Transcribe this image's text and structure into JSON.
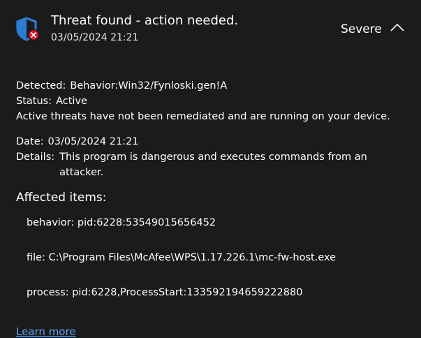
{
  "header": {
    "title": "Threat found - action needed.",
    "timestamp": "03/05/2024 21:21",
    "severity": "Severe",
    "icon": "shield-warning-icon",
    "accent_color": "#2b7cd3",
    "alert_color": "#e81123"
  },
  "threat": {
    "detected_label": "Detected:",
    "detected_value": "Behavior:Win32/Fynloski.gen!A",
    "status_label": "Status:",
    "status_value": "Active",
    "status_message": "Active threats have not been remediated and are running on your device.",
    "date_label": "Date:",
    "date_value": "03/05/2024 21:21",
    "details_label": "Details:",
    "details_value": "This program is dangerous and executes commands from an attacker."
  },
  "affected": {
    "title": "Affected items:",
    "items": [
      "behavior: pid:6228:53549015656452",
      "file: C:\\Program Files\\McAfee\\WPS\\1.17.226.1\\mc-fw-host.exe",
      "process: pid:6228,ProcessStart:133592194659222880"
    ]
  },
  "footer": {
    "learn_more": "Learn more"
  }
}
